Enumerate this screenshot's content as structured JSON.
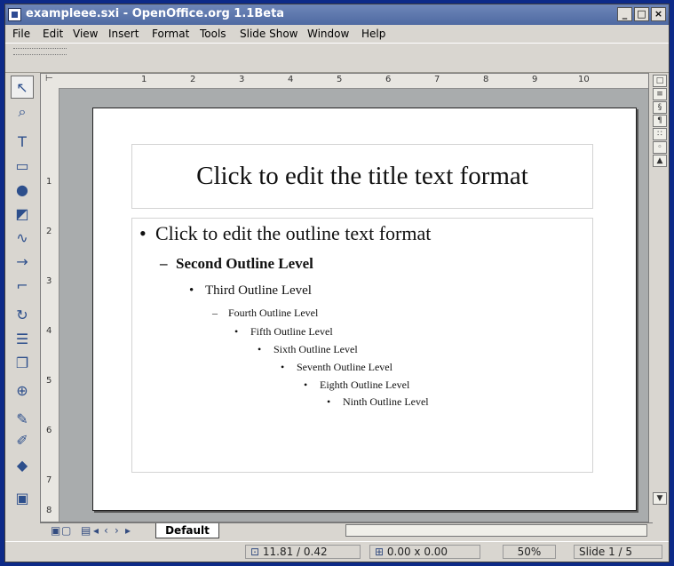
{
  "window": {
    "title": "exampleee.sxi - OpenOffice.org 1.1Beta",
    "controls": {
      "minimize": "_",
      "maximize": "□",
      "close": "×"
    }
  },
  "menu": [
    "File",
    "Edit",
    "View",
    "Insert",
    "Format",
    "Tools",
    "Slide Show",
    "Window",
    "Help"
  ],
  "toolbox": [
    {
      "icon": "select-arrow-icon"
    },
    {
      "icon": "zoom-icon"
    },
    {
      "icon": "text-icon"
    },
    {
      "icon": "rectangle-icon"
    },
    {
      "icon": "ellipse-icon"
    },
    {
      "icon": "3d-objects-icon"
    },
    {
      "icon": "curve-icon"
    },
    {
      "icon": "line-arrow-icon"
    },
    {
      "icon": "connector-icon"
    },
    {
      "icon": "rotate-icon"
    },
    {
      "icon": "alignment-icon"
    },
    {
      "icon": "arrange-icon"
    },
    {
      "icon": "insert-icon"
    },
    {
      "icon": "effects-icon"
    },
    {
      "icon": "3d-controller-icon"
    },
    {
      "icon": "slide-show-icon"
    }
  ],
  "ruler_marks": [
    "1",
    "2",
    "3",
    "4",
    "5",
    "6",
    "7",
    "8",
    "9",
    "10"
  ],
  "ruler_v_marks": [
    "1",
    "2",
    "3",
    "4",
    "5",
    "6",
    "7",
    "8"
  ],
  "slide": {
    "title_placeholder": "Click to edit the title text format",
    "outline": [
      {
        "bullet": "•",
        "text": "Click to edit the outline text format"
      },
      {
        "bullet": "–",
        "text": "Second Outline Level"
      },
      {
        "bullet": "•",
        "text": "Third Outline Level"
      },
      {
        "bullet": "–",
        "text": "Fourth Outline Level"
      },
      {
        "bullet": "•",
        "text": "Fifth Outline Level"
      },
      {
        "bullet": "•",
        "text": "Sixth Outline Level"
      },
      {
        "bullet": "•",
        "text": "Seventh Outline Level"
      },
      {
        "bullet": "•",
        "text": "Eighth Outline Level"
      },
      {
        "bullet": "•",
        "text": "Ninth Outline Level"
      }
    ]
  },
  "tabs": {
    "default": "Default"
  },
  "status": {
    "position": "11.81 / 0.42",
    "size": "0.00 x 0.00",
    "zoom": "50%",
    "slide": "Slide 1 / 5"
  }
}
